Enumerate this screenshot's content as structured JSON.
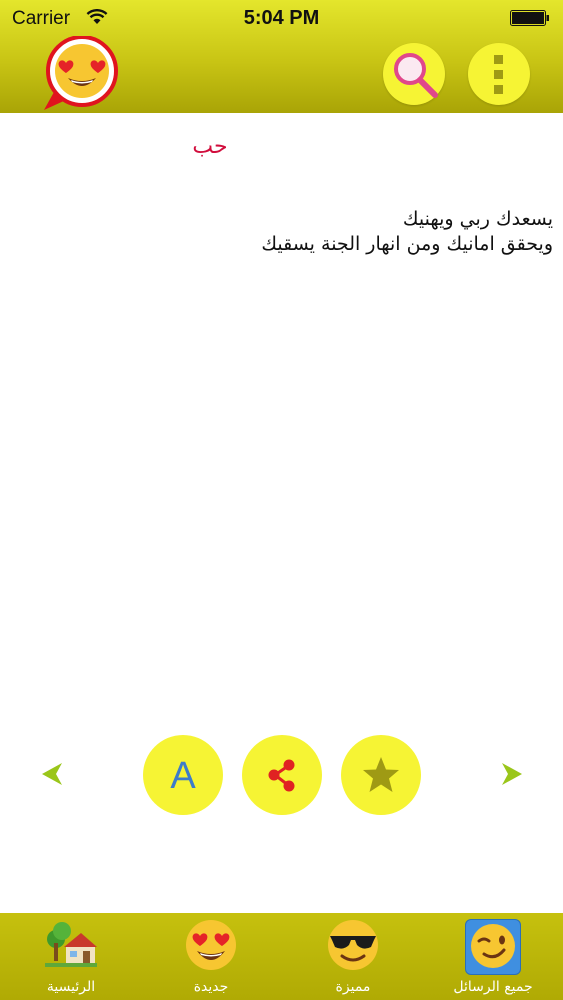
{
  "status_bar": {
    "carrier": "Carrier",
    "time": "5:04 PM"
  },
  "header": {
    "logo_icon": "heart-eyes-chat-bubble-icon",
    "search_icon": "magnifier-icon",
    "menu_icon": "vertical-dots-icon"
  },
  "content": {
    "category_title": "حب",
    "message_lines": [
      "يسعدك ربي ويهنيك",
      "ويحقق امانيك ومن انهار الجنة يسقيك"
    ]
  },
  "actions": {
    "font_label": "A",
    "share_icon": "share-icon",
    "favorite_icon": "star-icon",
    "prev_icon": "arrow-left-icon",
    "next_icon": "arrow-right-icon"
  },
  "tabs": [
    {
      "label": "الرئيسية",
      "icon": "house-icon"
    },
    {
      "label": "جديدة",
      "icon": "heart-eyes-icon"
    },
    {
      "label": "مميزة",
      "icon": "sunglasses-face-icon"
    },
    {
      "label": "جميع الرسائل",
      "icon": "winking-face-icon",
      "selected": true
    }
  ],
  "colors": {
    "header_yellow": "#c8c414",
    "button_yellow": "#f6f434",
    "title_red": "#d10d3c",
    "arrow_green": "#9ac61a",
    "font_blue": "#3d7cc9",
    "share_red": "#e02222"
  }
}
